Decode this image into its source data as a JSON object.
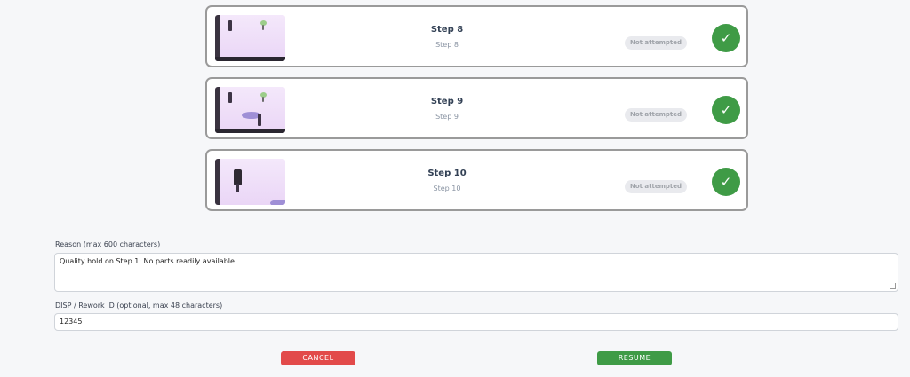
{
  "steps": [
    {
      "title": "Step 8",
      "subtitle": "Step 8",
      "status": "Not attempted",
      "check": "✓"
    },
    {
      "title": "Step 9",
      "subtitle": "Step 9",
      "status": "Not attempted",
      "check": "✓"
    },
    {
      "title": "Step 10",
      "subtitle": "Step 10",
      "status": "Not attempted",
      "check": "✓"
    }
  ],
  "form": {
    "reason_label": "Reason (max 600 characters)",
    "reason_value": "Quality hold on Step 1: No parts readily available",
    "disp_label": "DISP / Rework ID (optional, max 48 characters)",
    "disp_value": "12345"
  },
  "buttons": {
    "cancel": "CANCEL",
    "resume": "RESUME"
  },
  "colors": {
    "success": "#3f9b46",
    "danger": "#e24a4a",
    "badge_bg": "#e9eaee"
  },
  "icons": {
    "check": "check-icon"
  }
}
